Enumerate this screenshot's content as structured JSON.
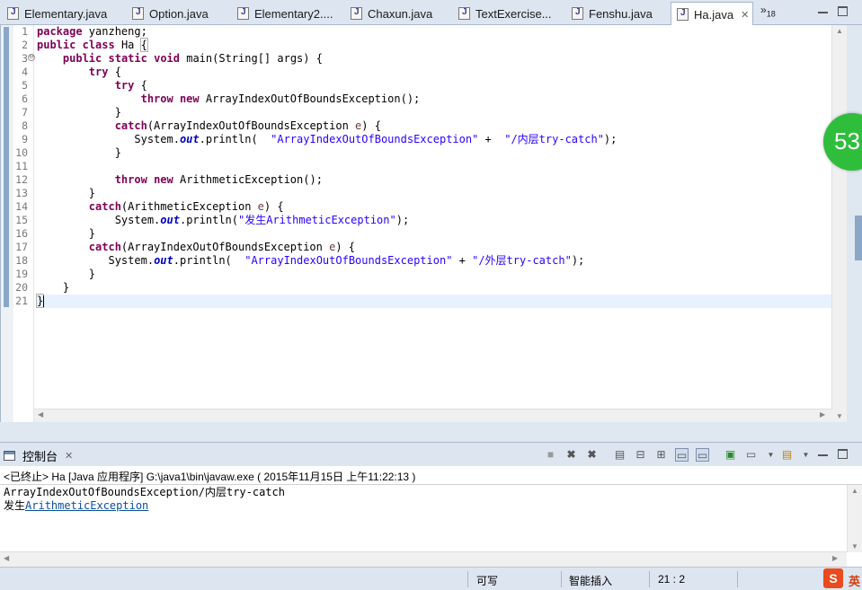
{
  "tabs": [
    {
      "label": "Elementary.java"
    },
    {
      "label": "Option.java"
    },
    {
      "label": "Elementary2...."
    },
    {
      "label": "Chaxun.java"
    },
    {
      "label": "TextExercise..."
    },
    {
      "label": "Fenshu.java"
    },
    {
      "label": "Ha.java",
      "active": true
    }
  ],
  "tab_overflow": {
    "symbol": "»",
    "count": "18"
  },
  "editor": {
    "line_numbers": [
      "1",
      "2",
      "3",
      "4",
      "5",
      "6",
      "7",
      "8",
      "9",
      "10",
      "11",
      "12",
      "13",
      "14",
      "15",
      "16",
      "17",
      "18",
      "19",
      "20",
      "21"
    ],
    "fold_marker": "⊖",
    "code": {
      "l1": {
        "kw": "package",
        "rest": " yanzheng;"
      },
      "l2": {
        "kw1": "public",
        "kw2": "class",
        "name": " Ha ",
        "brace": "{"
      },
      "l3": {
        "indent": "    ",
        "kw1": "public",
        "kw2": "static",
        "kw3": "void",
        "rest": " main(String[] args) {"
      },
      "l4": {
        "indent": "        ",
        "kw": "try",
        "rest": " {"
      },
      "l5": {
        "indent": "            ",
        "kw": "try",
        "rest": " {"
      },
      "l6": {
        "indent": "                ",
        "kw1": "throw",
        "kw2": "new",
        "rest": " ArrayIndexOutOfBoundsException();"
      },
      "l7": {
        "text": "            }"
      },
      "l8": {
        "indent": "            ",
        "kw": "catch",
        "pre": "(ArrayIndexOutOfBoundsException ",
        "var": "e",
        "post": ") {"
      },
      "l9": {
        "indent": "               ",
        "pre": "System.",
        "fld": "out",
        "mid": ".println(  ",
        "str1": "\"ArrayIndexOutOfBoundsException\"",
        "mid2": " +  ",
        "str2": "\"/内层try-catch\"",
        "post": ");"
      },
      "l10": {
        "text": "            }"
      },
      "l11": {
        "text": ""
      },
      "l12": {
        "indent": "            ",
        "kw1": "throw",
        "kw2": "new",
        "rest": " ArithmeticException();"
      },
      "l13": {
        "text": "        }"
      },
      "l14": {
        "indent": "        ",
        "kw": "catch",
        "pre": "(ArithmeticException ",
        "var": "e",
        "post": ") {"
      },
      "l15": {
        "indent": "            ",
        "pre": "System.",
        "fld": "out",
        "mid": ".println(",
        "str1": "\"发生ArithmeticException\"",
        "post": ");"
      },
      "l16": {
        "text": "        }"
      },
      "l17": {
        "indent": "        ",
        "kw": "catch",
        "pre": "(ArrayIndexOutOfBoundsException ",
        "var": "e",
        "post": ") {"
      },
      "l18": {
        "indent": "           ",
        "pre": "System.",
        "fld": "out",
        "mid": ".println(  ",
        "str1": "\"ArrayIndexOutOfBoundsException\"",
        "mid2": " + ",
        "str2": "\"/外层try-catch\"",
        "post": ");"
      },
      "l19": {
        "text": "        }"
      },
      "l20": {
        "text": "    }"
      },
      "l21": {
        "text": "}"
      }
    }
  },
  "badge": {
    "value": "53"
  },
  "console": {
    "title": "控制台",
    "status": "<已终止> Ha [Java 应用程序] G:\\java1\\bin\\javaw.exe ( 2015年11月15日 上午11:22:13 )",
    "output": {
      "line1": "ArrayIndexOutOfBoundsException/内层try-catch",
      "line2_prefix": "发生",
      "line2_link": "ArithmeticException"
    }
  },
  "statusbar": {
    "writable": "可写",
    "insert_mode": "智能插入",
    "position": "21 : 2"
  },
  "ime": {
    "logo": "S",
    "label": "英"
  },
  "icons": [
    "java-file-icon",
    "close-icon",
    "minimize-icon",
    "maximize-icon",
    "console-icon",
    "terminate-icon",
    "remove-launch-icon",
    "remove-all-icon",
    "clear-console-icon",
    "scroll-lock-icon",
    "pin-console-icon",
    "display-console-icon",
    "open-console-icon"
  ]
}
